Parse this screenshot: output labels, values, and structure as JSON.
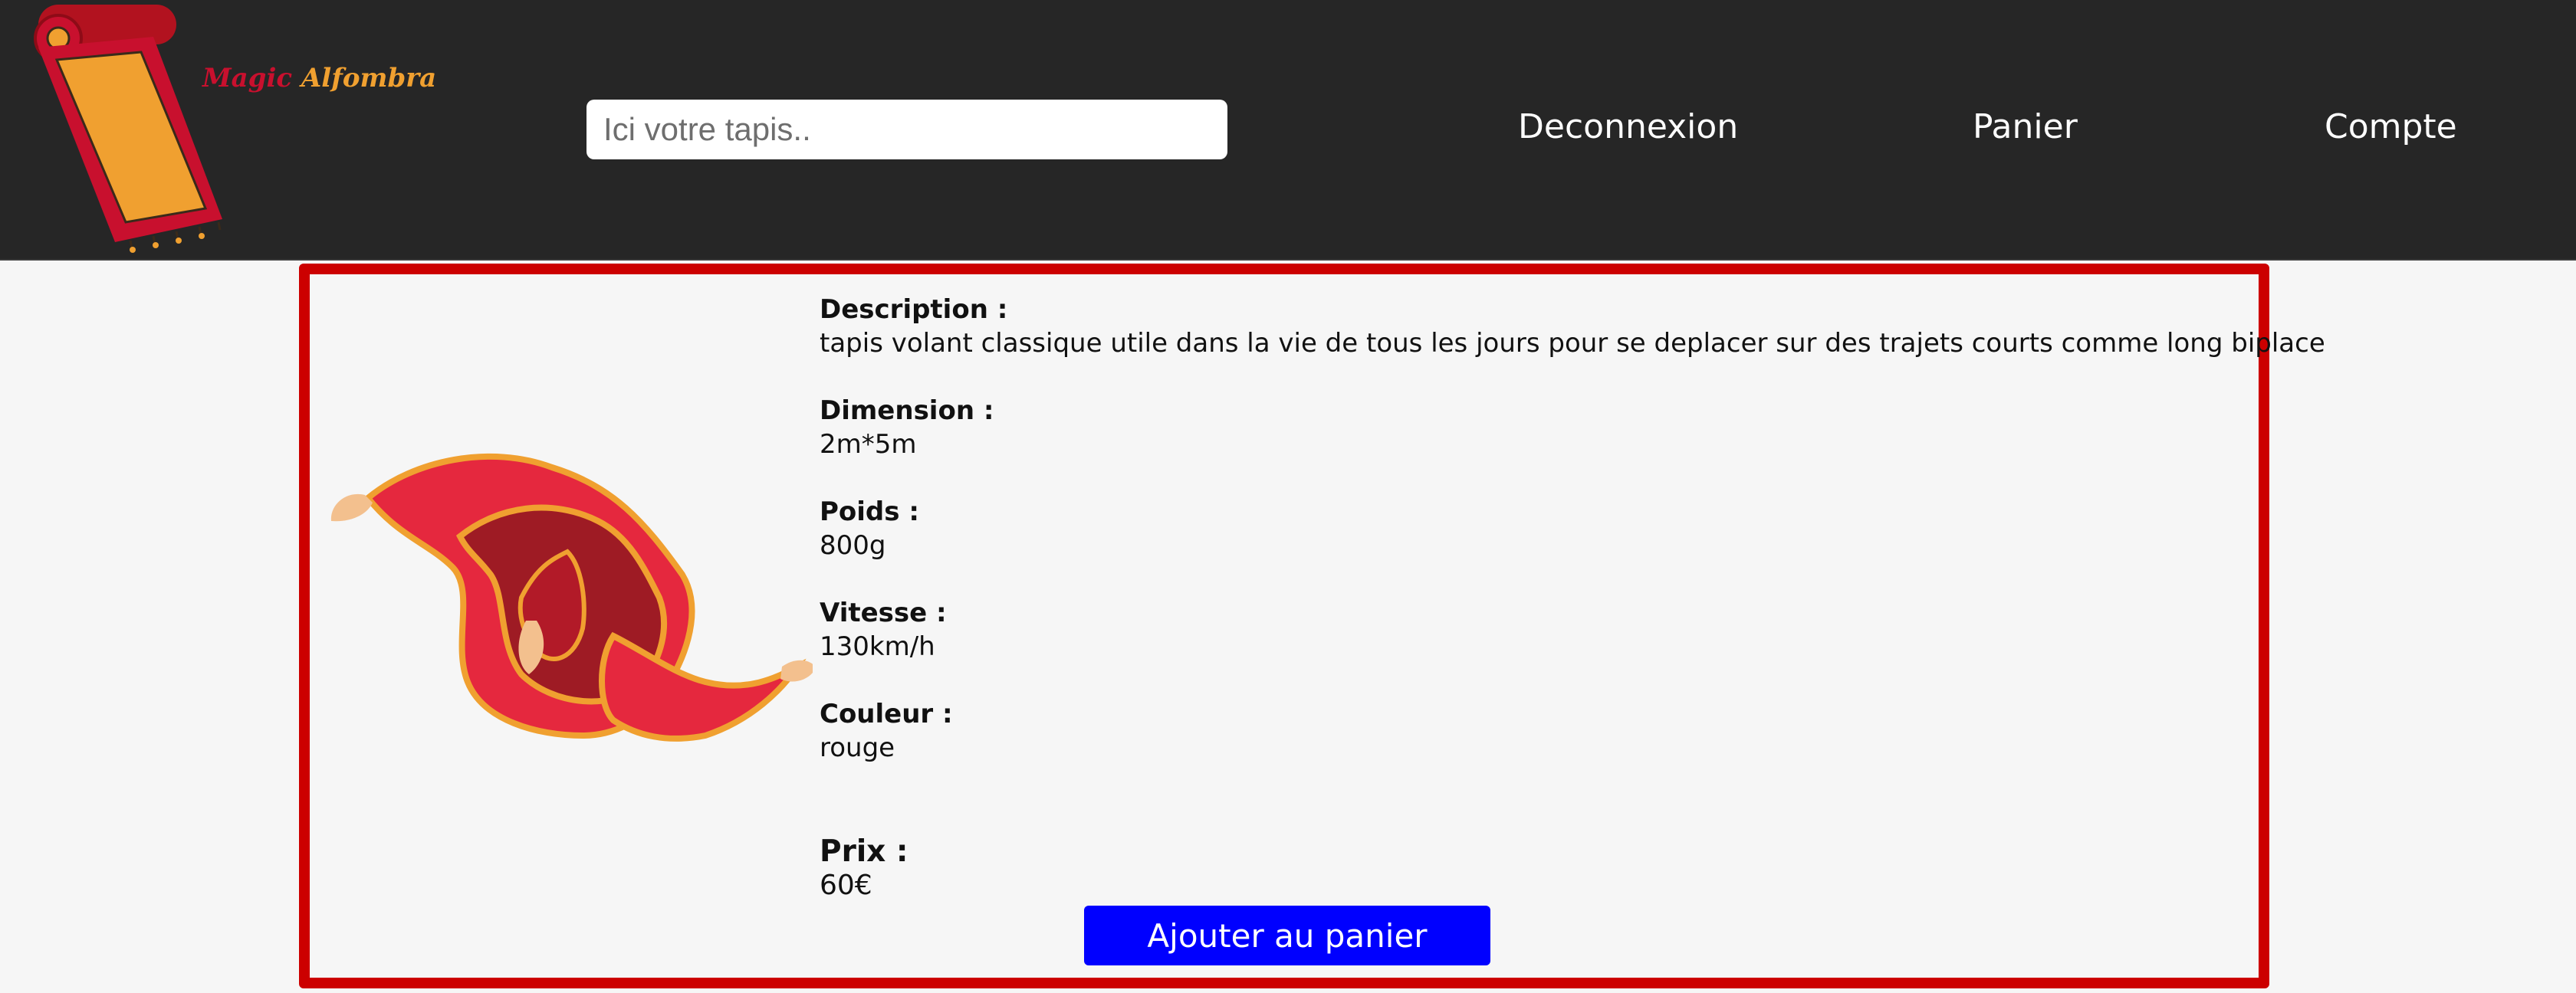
{
  "header": {
    "logo": {
      "word1": "Magic",
      "word2": "Alfombra"
    },
    "search": {
      "placeholder": "Ici votre tapis..",
      "value": ""
    },
    "nav": {
      "logout": "Deconnexion",
      "cart": "Panier",
      "account": "Compte"
    }
  },
  "product": {
    "description_label": "Description :",
    "description": "tapis volant classique utile dans la vie de tous les jours pour se deplacer sur des trajets courts comme long biplace",
    "dimension_label": "Dimension :",
    "dimension": "2m*5m",
    "weight_label": "Poids :",
    "weight": "800g",
    "speed_label": "Vitesse :",
    "speed": "130km/h",
    "color_label": "Couleur :",
    "color": "rouge",
    "price_label": "Prix :",
    "price": "60€",
    "add_to_cart": "Ajouter au panier"
  },
  "colors": {
    "header_bg": "#262626",
    "card_border": "#cc0000",
    "button_bg": "#0000ff",
    "page_bg": "#f6f6f6"
  }
}
